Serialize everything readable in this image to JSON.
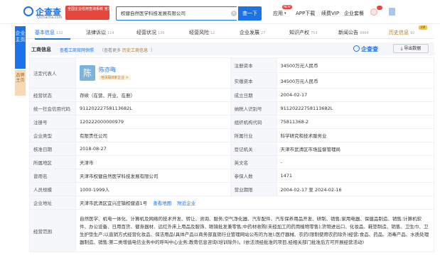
{
  "header": {
    "logo_text": "企查查",
    "logo_sub": "Qichacha.com",
    "badge": "全国企业信用查询系统 官方备案企业征信机构",
    "search_value": "权健自然医学科技发展有限公司",
    "search_button": "查一下",
    "nav": [
      "应用",
      "APP下载",
      "续费VIP",
      "企业套餐"
    ],
    "new_tag": "NEW"
  },
  "sidebar": {
    "primary": "企业主页",
    "secondary": "品牌主页"
  },
  "tabs": [
    {
      "label": "基本信息",
      "count": "132"
    },
    {
      "label": "法律诉讼",
      "count": "114"
    },
    {
      "label": "经营状况",
      "count": "136"
    },
    {
      "label": "经营风险",
      "count": "12"
    },
    {
      "label": "企业发展",
      "count": "27"
    },
    {
      "label": "知识产权",
      "count": "753"
    },
    {
      "label": "新闻公告",
      "count": "9964"
    },
    {
      "label": "历史信息",
      "count": "92"
    }
  ],
  "vip_tag": "VIP",
  "section": {
    "title": "工商信息",
    "link1": "查看工商官网快照",
    "note": "（查看更多",
    "link2": "历史工商信息",
    "note_end": "）",
    "brand": "企查查",
    "export": "导出数据"
  },
  "info": {
    "legal_rep_label": "法定代表人",
    "legal_rep_avatar": "陈",
    "legal_rep_name": "陈亦晦",
    "legal_rep_tag": "他关联8家企业 >",
    "reg_capital_label": "注册资本",
    "reg_capital": "34500万元人民币",
    "paid_capital_label": "实缴资本",
    "paid_capital": "34500万元人民币",
    "status_label": "经营状态",
    "status": "存续（在营、开业、在册）",
    "founded_label": "成立日期",
    "founded": "2004-02-17",
    "credit_code_label": "统一社会信用代码",
    "credit_code": "91120222758113682L",
    "tax_id_label": "纳税人识别号",
    "tax_id": "91120222758113682L",
    "reg_no_label": "注册号",
    "reg_no": "120222000000979",
    "org_code_label": "组织机构代码",
    "org_code": "75811368-2",
    "type_label": "企业类型",
    "type": "有限责任公司",
    "industry_label": "所属行业",
    "industry": "科学研究和技术服务业",
    "approved_label": "核准日期",
    "approved": "2018-08-27",
    "authority_label": "登记机关",
    "authority": "天津市武清区市场监督管理局",
    "region_label": "所属地区",
    "region": "天津市",
    "en_name_label": "英文名",
    "en_name": "-",
    "former_name_label": "曾用名",
    "former_name": "天津市权健自然医学科技发展有限公司",
    "insured_label": "参保人数",
    "insured": "1471",
    "staff_label": "人员规模",
    "staff": "1000-1999人",
    "term_label": "营业期限",
    "term": "2004-02-17 至 2024-02-16",
    "address_label": "企业地址",
    "address": "天津市武清区宜兴庄镇权健道1号",
    "address_link1": "查看地图",
    "address_link2": "附近企业",
    "scope_label": "经营范围",
    "scope": "自然医学、机电一体化、计算机及网络的技术开发、转让、咨询、服务;空气净化器、汽车配件、汽车保养用品开发、研制、销售;家用电器、保健品制造、销售;计算机软件、办公设备、日用百货、健身器材、远红外床上用品及服饰、眼镜批发兼零售;中药材收购(未经加工的药用植物零售);货物进出口、化妆品、鞋垫制造、销售、卫生巾、卫生护垫生产;以直销方式经营化妆品、保洁用品(具体产品以商务部直销行业管理网站公布的为准);医疗器械、农药(限制使用农药除外)经营;食品、药品、消毒产品、水质处理器制造、销售;第二类增值电信业务中的呼叫中心业务;教育信息咨询(培训除外)。(依法须经批准的项目,经相关部门批准后方可开展经营活动)"
  },
  "colors": {
    "accent": "#1a73e8",
    "badge": "#e7463c",
    "history": "#b07a2a"
  }
}
